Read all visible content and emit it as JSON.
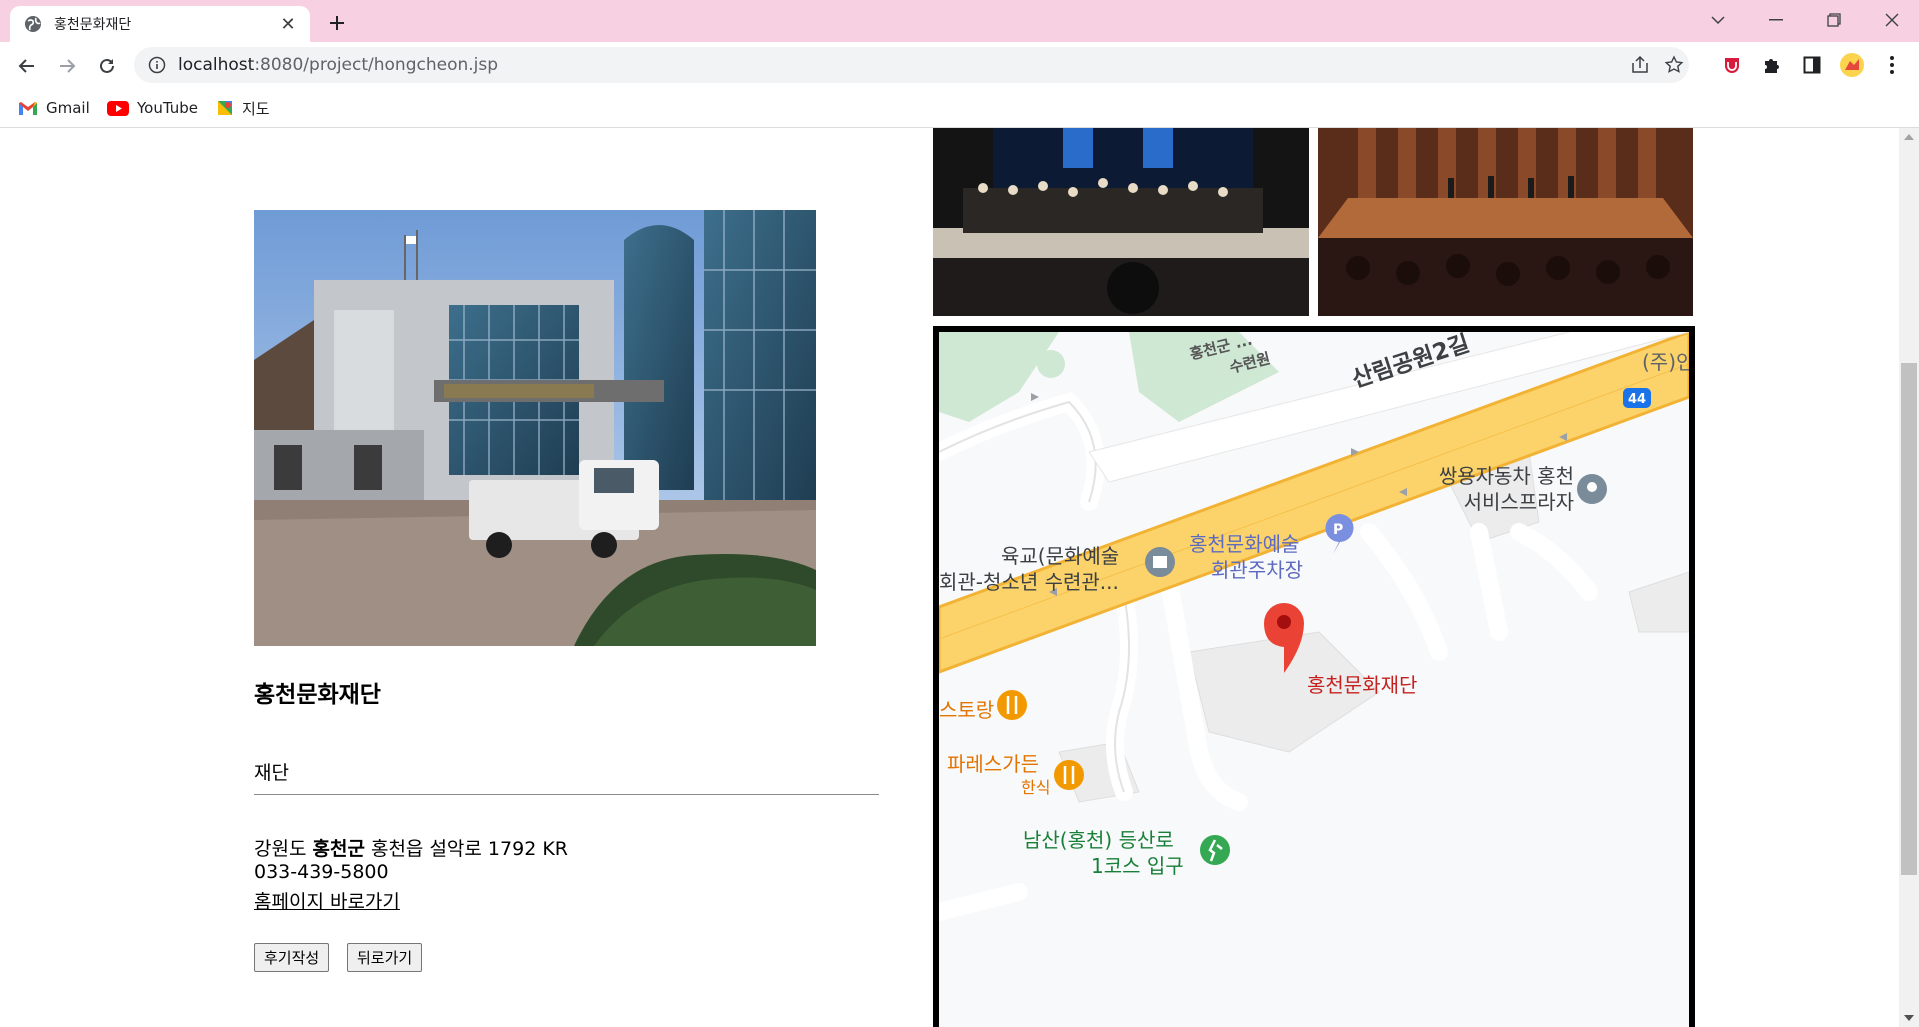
{
  "browser": {
    "tab_title": "홍천문화재단",
    "url_host": "localhost",
    "url_rest": ":8080/project/hongcheon.jsp"
  },
  "bookmarks": [
    {
      "label": "Gmail",
      "icon": "gmail-icon"
    },
    {
      "label": "YouTube",
      "icon": "youtube-icon"
    },
    {
      "label": "지도",
      "icon": "maps-icon"
    }
  ],
  "place": {
    "name": "홍천문화재단",
    "category": "재단",
    "address_pre": "강원도 ",
    "address_bold": "홍천군",
    "address_post": " 홍천읍 설악로 1792 KR",
    "phone": "033-439-5800",
    "homepage_link": "홈페이지 바로가기"
  },
  "buttons": {
    "review": "후기작성",
    "back": "뒤로가기"
  },
  "map": {
    "labels": {
      "top_center_1": "홍천군 ...",
      "top_center_2": "수련원",
      "road_name": "산림공원2길",
      "road_number": "44",
      "company_partial": "(주)인",
      "ssangyong_1": "쌍용자동차 홍천",
      "ssangyong_2": "서비스프라자",
      "parking_1": "홍천문화예술",
      "parking_2": "회관주차장",
      "youth_1": "육교(문화예술",
      "youth_2": "회관-청소년 수련관...",
      "main_pin": "홍천문화재단",
      "restaurant_partial": "스토랑",
      "paris_1": "파레스가든",
      "paris_2": "한식",
      "trail_1": "남산(홍천) 등산로",
      "trail_2": "1코스 입구"
    },
    "colors": {
      "road": "#fcd36b",
      "road_edge": "#f2b335",
      "park": "#cfe8d4",
      "pin_red": "#ea4335",
      "poi_orange": "#f29900",
      "poi_blue": "#7b8fe0",
      "poi_green": "#34a853"
    }
  }
}
